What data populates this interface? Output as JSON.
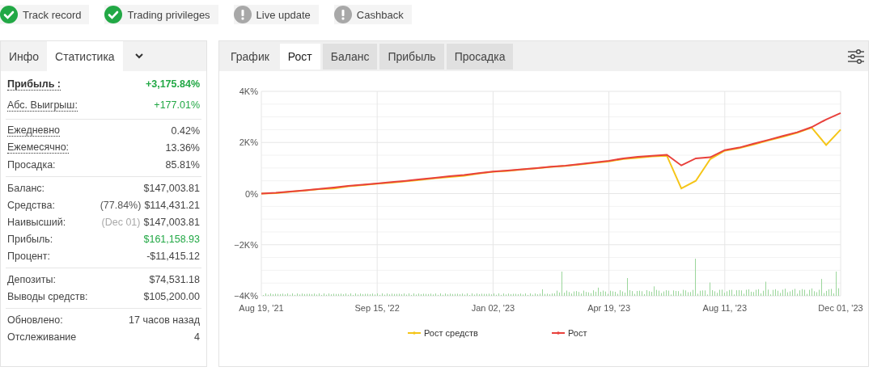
{
  "badges": [
    {
      "label": "Track record",
      "verified": true
    },
    {
      "label": "Trading privileges",
      "verified": true
    },
    {
      "label": "Live update",
      "verified": false
    },
    {
      "label": "Cashback",
      "verified": false
    }
  ],
  "stats_panel": {
    "tabs": [
      {
        "label": "Инфо",
        "selected": false
      },
      {
        "label": "Статистика",
        "selected": true
      }
    ],
    "groups": [
      {
        "rows": [
          {
            "label": "Прибыль :",
            "value": "+3,175.84%",
            "underlined": true,
            "bold": true,
            "highlight": true
          },
          {
            "label": "Абс. Выигрыш:",
            "value": "+177.01%",
            "underlined": true,
            "bold": false,
            "highlight": true
          }
        ]
      },
      {
        "rows": [
          {
            "label": "Ежедневно",
            "value": "0.42%",
            "underlined": true,
            "bold": false,
            "highlight": false
          },
          {
            "label": "Ежемесячно:",
            "value": "13.36%",
            "underlined": true,
            "bold": false,
            "highlight": false
          },
          {
            "label": "Просадка:",
            "value": "85.81%",
            "underlined": false,
            "bold": false,
            "highlight": false
          }
        ]
      },
      {
        "rows": [
          {
            "label": "Баланс:",
            "value": "$147,003.81",
            "underlined": false,
            "bold": false,
            "highlight": false
          },
          {
            "label": "Средства:",
            "note": "(77.84%)",
            "note_muted": false,
            "value": "$114,431.21",
            "underlined": false,
            "bold": false,
            "highlight": false
          },
          {
            "label": "Наивысший:",
            "note": "(Dec 01)",
            "note_muted": true,
            "value": "$147,003.81",
            "underlined": false,
            "bold": false,
            "highlight": false
          },
          {
            "label": "Прибыль:",
            "value": "$161,158.93",
            "underlined": false,
            "bold": false,
            "highlight": true
          },
          {
            "label": "Процент:",
            "value": "-$11,415.12",
            "underlined": false,
            "bold": false,
            "highlight": false
          }
        ]
      },
      {
        "rows": [
          {
            "label": "Депозиты:",
            "value": "$74,531.18",
            "underlined": false,
            "bold": false,
            "highlight": false
          },
          {
            "label": "Выводы средств:",
            "value": "$105,200.00",
            "underlined": false,
            "bold": false,
            "highlight": false
          }
        ]
      },
      {
        "rows": [
          {
            "label": "Обновлено:",
            "value": "17 часов назад",
            "underlined": false,
            "bold": false,
            "highlight": false
          },
          {
            "label": "Отслеживание",
            "value": "4",
            "underlined": false,
            "bold": false,
            "highlight": false
          }
        ]
      }
    ]
  },
  "chart_panel": {
    "tabs": [
      {
        "label": "График",
        "selected": false
      },
      {
        "label": "Рост",
        "selected": true
      },
      {
        "label": "Баланс",
        "selected": false,
        "shaded": true
      },
      {
        "label": "Прибыль",
        "selected": false,
        "shaded": true
      },
      {
        "label": "Просадка",
        "selected": false,
        "shaded": true
      }
    ],
    "chart_data": {
      "type": "line",
      "categories": [
        "Aug 19, '21",
        null,
        null,
        null,
        null,
        null,
        null,
        null,
        "Sep 15, '22",
        null,
        null,
        null,
        null,
        null,
        null,
        null,
        "Jan 02, '23",
        null,
        null,
        null,
        null,
        null,
        null,
        null,
        "Apr 19, '23",
        null,
        null,
        null,
        null,
        null,
        null,
        null,
        "Aug 11, '23",
        null,
        null,
        null,
        null,
        null,
        null,
        null,
        "Dec 01, '23"
      ],
      "series": [
        {
          "name": "Рост средств",
          "color": "#f5c518",
          "values": [
            0,
            20,
            70,
            120,
            170,
            200,
            280,
            330,
            390,
            430,
            480,
            540,
            600,
            650,
            700,
            780,
            850,
            890,
            940,
            990,
            1040,
            1080,
            1140,
            1200,
            1260,
            1350,
            1400,
            1450,
            1480,
            200,
            500,
            1350,
            1680,
            1780,
            1920,
            2080,
            2220,
            2380,
            2580,
            1900,
            2500
          ]
        },
        {
          "name": "Рост",
          "color": "#e8413c",
          "values": [
            0,
            30,
            80,
            130,
            180,
            240,
            300,
            350,
            400,
            450,
            500,
            560,
            620,
            680,
            730,
            800,
            860,
            900,
            950,
            1000,
            1050,
            1090,
            1150,
            1220,
            1280,
            1380,
            1440,
            1480,
            1520,
            1100,
            1380,
            1420,
            1700,
            1800,
            1950,
            2100,
            2250,
            2400,
            2600,
            2900,
            3150
          ]
        }
      ],
      "ylim": [
        -4000,
        4000
      ],
      "grid": true,
      "legend": true,
      "yticks": [
        {
          "value": 4000,
          "label": "4K%"
        },
        {
          "value": 2000,
          "label": "2K%"
        },
        {
          "value": 0,
          "label": "0%"
        },
        {
          "value": -2000,
          "label": "−2K%"
        },
        {
          "value": -4000,
          "label": "−4K%"
        }
      ]
    }
  }
}
